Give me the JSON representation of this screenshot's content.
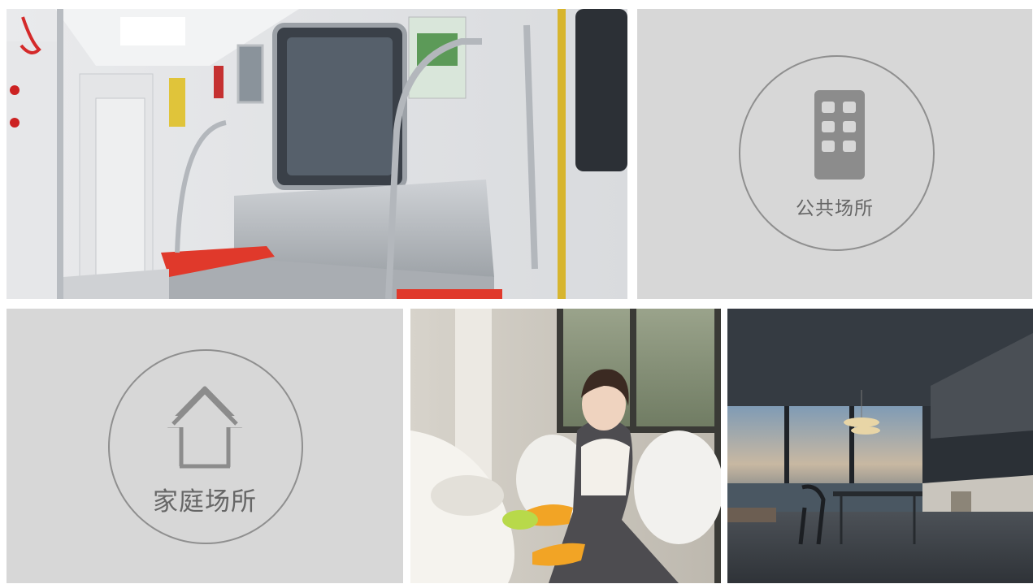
{
  "categories": {
    "public": {
      "label": "公共场所",
      "icon": "building-icon"
    },
    "home": {
      "label": "家庭场所",
      "icon": "house-icon"
    }
  },
  "photos": [
    "subway-car-interior-photo",
    "woman-cleaning-toilet-photo",
    "modern-kitchen-interior-photo"
  ],
  "colors": {
    "tile_background": "#d7d7d7",
    "icon_gray": "#8c8c8c",
    "label_gray": "#666666",
    "page_background": "#ffffff"
  }
}
